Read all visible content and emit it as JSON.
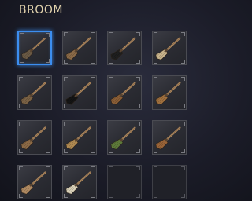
{
  "header": {
    "title": "BROOM"
  },
  "inventory": {
    "selected_index": 0,
    "slots": [
      {
        "icon": "broom-icon",
        "bristle_color": "#6b5a45",
        "empty": false
      },
      {
        "icon": "broom-icon",
        "bristle_color": "#8a6a48",
        "empty": false
      },
      {
        "icon": "broom-icon",
        "bristle_color": "#1e1e1e",
        "empty": false
      },
      {
        "icon": "broom-icon",
        "bristle_color": "#c9b48c",
        "empty": false
      },
      {
        "icon": "broom-icon",
        "bristle_color": "#7a6245",
        "empty": false
      },
      {
        "icon": "broom-icon",
        "bristle_color": "#141414",
        "empty": false
      },
      {
        "icon": "broom-icon",
        "bristle_color": "#8a5e36",
        "empty": false
      },
      {
        "icon": "broom-icon",
        "bristle_color": "#a0703e",
        "empty": false
      },
      {
        "icon": "broom-icon",
        "bristle_color": "#8c6a46",
        "empty": false
      },
      {
        "icon": "broom-icon",
        "bristle_color": "#b08a52",
        "empty": false
      },
      {
        "icon": "broom-icon",
        "bristle_color": "#5e7a3a",
        "empty": false
      },
      {
        "icon": "broom-icon",
        "bristle_color": "#9a6438",
        "empty": false
      },
      {
        "icon": "broom-icon",
        "bristle_color": "#b08a62",
        "empty": false
      },
      {
        "icon": "broom-icon",
        "bristle_color": "#d8d0b8",
        "empty": false
      },
      {
        "icon": "",
        "bristle_color": "",
        "empty": true
      },
      {
        "icon": "",
        "bristle_color": "",
        "empty": true
      }
    ]
  },
  "colors": {
    "selection": "#3c8ef0",
    "title": "#e2d3ad",
    "handle": "#b08a60"
  }
}
